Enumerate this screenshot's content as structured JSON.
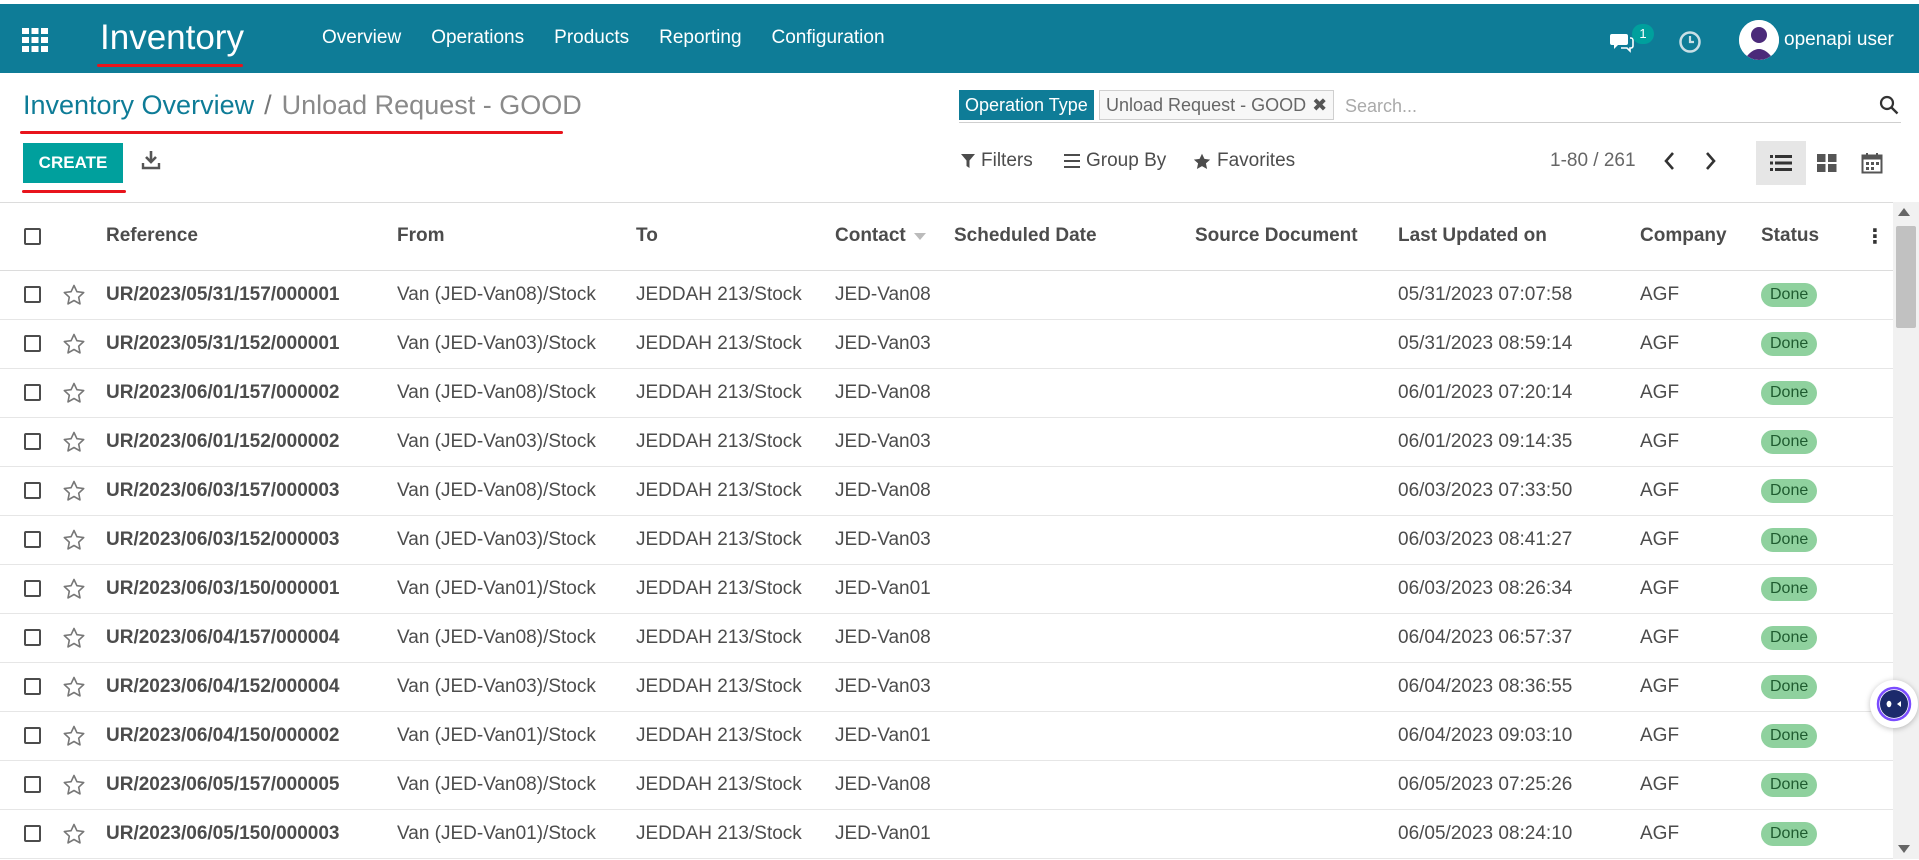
{
  "topbar": {
    "app_title": "Inventory",
    "menu": [
      "Overview",
      "Operations",
      "Products",
      "Reporting",
      "Configuration"
    ],
    "chat_count": "1",
    "user_name": "openapi user",
    "bg_color": "#0e7c97"
  },
  "breadcrumb": {
    "parent": "Inventory Overview",
    "separator": "/",
    "current": "Unload Request - GOOD"
  },
  "actions": {
    "create_label": "CREATE"
  },
  "search": {
    "facet_label": "Operation Type",
    "facet_value": "Unload Request - GOOD",
    "facet_close": "✖",
    "placeholder": "Search..."
  },
  "filters": {
    "filters_label": "Filters",
    "group_by_label": "Group By",
    "favorites_label": "Favorites"
  },
  "pager": {
    "text": "1-80 / 261"
  },
  "table": {
    "columns": [
      "Reference",
      "From",
      "To",
      "Contact",
      "Scheduled Date",
      "Source Document",
      "Last Updated on",
      "Company",
      "Status"
    ],
    "rows": [
      {
        "reference": "UR/2023/05/31/157/000001",
        "from": "Van (JED-Van08)/Stock",
        "to": "JEDDAH 213/Stock",
        "contact": "JED-Van08",
        "scheduled": "",
        "source": "",
        "updated": "05/31/2023 07:07:58",
        "company": "AGF",
        "status": "Done"
      },
      {
        "reference": "UR/2023/05/31/152/000001",
        "from": "Van (JED-Van03)/Stock",
        "to": "JEDDAH 213/Stock",
        "contact": "JED-Van03",
        "scheduled": "",
        "source": "",
        "updated": "05/31/2023 08:59:14",
        "company": "AGF",
        "status": "Done"
      },
      {
        "reference": "UR/2023/06/01/157/000002",
        "from": "Van (JED-Van08)/Stock",
        "to": "JEDDAH 213/Stock",
        "contact": "JED-Van08",
        "scheduled": "",
        "source": "",
        "updated": "06/01/2023 07:20:14",
        "company": "AGF",
        "status": "Done"
      },
      {
        "reference": "UR/2023/06/01/152/000002",
        "from": "Van (JED-Van03)/Stock",
        "to": "JEDDAH 213/Stock",
        "contact": "JED-Van03",
        "scheduled": "",
        "source": "",
        "updated": "06/01/2023 09:14:35",
        "company": "AGF",
        "status": "Done"
      },
      {
        "reference": "UR/2023/06/03/157/000003",
        "from": "Van (JED-Van08)/Stock",
        "to": "JEDDAH 213/Stock",
        "contact": "JED-Van08",
        "scheduled": "",
        "source": "",
        "updated": "06/03/2023 07:33:50",
        "company": "AGF",
        "status": "Done"
      },
      {
        "reference": "UR/2023/06/03/152/000003",
        "from": "Van (JED-Van03)/Stock",
        "to": "JEDDAH 213/Stock",
        "contact": "JED-Van03",
        "scheduled": "",
        "source": "",
        "updated": "06/03/2023 08:41:27",
        "company": "AGF",
        "status": "Done"
      },
      {
        "reference": "UR/2023/06/03/150/000001",
        "from": "Van (JED-Van01)/Stock",
        "to": "JEDDAH 213/Stock",
        "contact": "JED-Van01",
        "scheduled": "",
        "source": "",
        "updated": "06/03/2023 08:26:34",
        "company": "AGF",
        "status": "Done"
      },
      {
        "reference": "UR/2023/06/04/157/000004",
        "from": "Van (JED-Van08)/Stock",
        "to": "JEDDAH 213/Stock",
        "contact": "JED-Van08",
        "scheduled": "",
        "source": "",
        "updated": "06/04/2023 06:57:37",
        "company": "AGF",
        "status": "Done"
      },
      {
        "reference": "UR/2023/06/04/152/000004",
        "from": "Van (JED-Van03)/Stock",
        "to": "JEDDAH 213/Stock",
        "contact": "JED-Van03",
        "scheduled": "",
        "source": "",
        "updated": "06/04/2023 08:36:55",
        "company": "AGF",
        "status": "Done"
      },
      {
        "reference": "UR/2023/06/04/150/000002",
        "from": "Van (JED-Van01)/Stock",
        "to": "JEDDAH 213/Stock",
        "contact": "JED-Van01",
        "scheduled": "",
        "source": "",
        "updated": "06/04/2023 09:03:10",
        "company": "AGF",
        "status": "Done"
      },
      {
        "reference": "UR/2023/06/05/157/000005",
        "from": "Van (JED-Van08)/Stock",
        "to": "JEDDAH 213/Stock",
        "contact": "JED-Van08",
        "scheduled": "",
        "source": "",
        "updated": "06/05/2023 07:25:26",
        "company": "AGF",
        "status": "Done"
      },
      {
        "reference": "UR/2023/06/05/150/000003",
        "from": "Van (JED-Van01)/Stock",
        "to": "JEDDAH 213/Stock",
        "contact": "JED-Van01",
        "scheduled": "",
        "source": "",
        "updated": "06/05/2023 08:24:10",
        "company": "AGF",
        "status": "Done"
      }
    ]
  },
  "colors": {
    "accent": "#00a09d",
    "annotation": "#e8141c",
    "done_badge": "#8fd19e"
  }
}
